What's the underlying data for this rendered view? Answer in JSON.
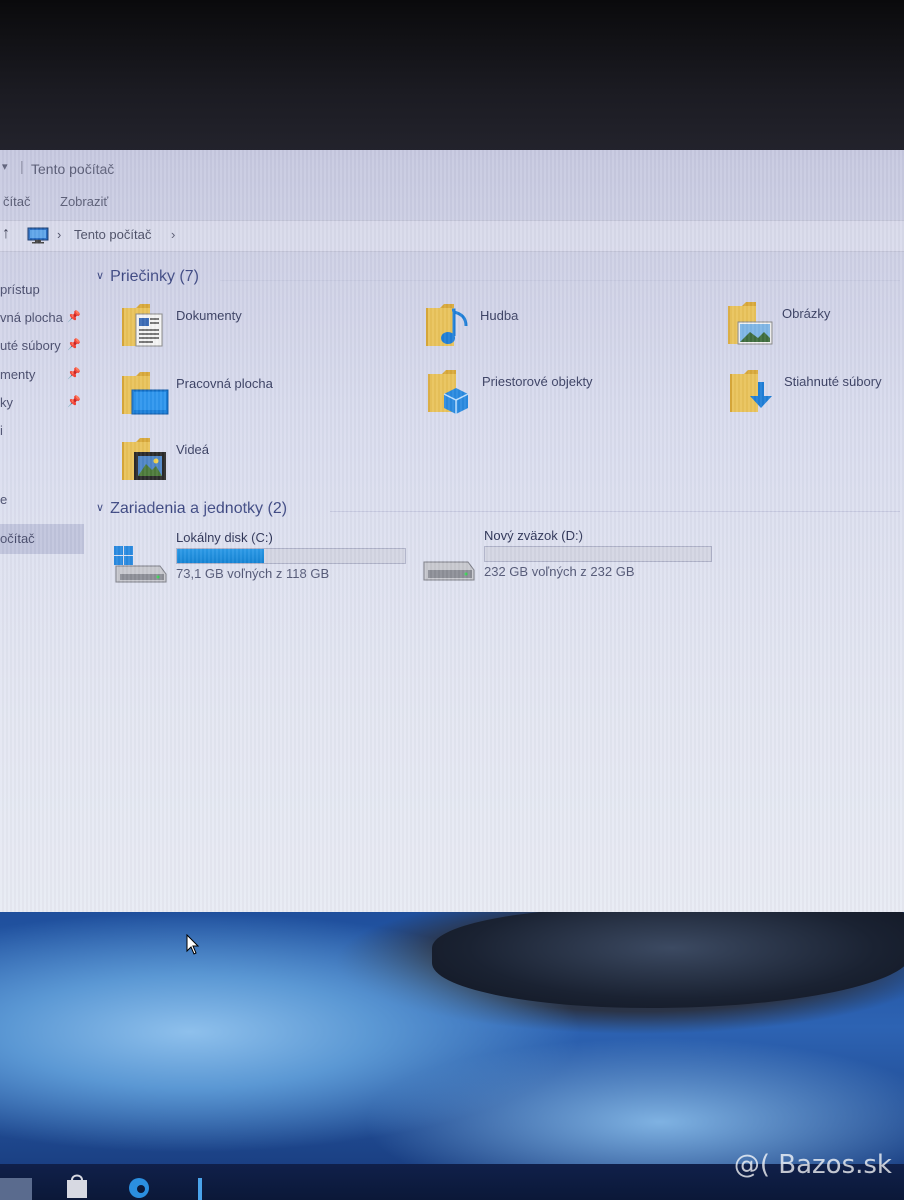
{
  "window": {
    "title": "Tento počítač",
    "quick_access_glyph": "▾",
    "separator": "|"
  },
  "ribbon": {
    "tabs": [
      "čítač",
      "Zobraziť"
    ]
  },
  "address": {
    "up_glyph": "↑",
    "chevron": "›",
    "crumb": "Tento počítač"
  },
  "nav": {
    "items": [
      {
        "label": "prístup",
        "pinned": false
      },
      {
        "label": "vná plocha",
        "pinned": true
      },
      {
        "label": "uté súbory",
        "pinned": true
      },
      {
        "label": "menty",
        "pinned": true
      },
      {
        "label": "ky",
        "pinned": true
      },
      {
        "label": "i",
        "pinned": false
      },
      {
        "label": "e",
        "pinned": false
      },
      {
        "label": "očítač",
        "pinned": false,
        "selected": true
      }
    ],
    "pin_glyph": "📌"
  },
  "folders": {
    "heading": "Priečinky (7)",
    "items": [
      {
        "label": "Dokumenty",
        "icon": "documents-folder-icon"
      },
      {
        "label": "Hudba",
        "icon": "music-folder-icon"
      },
      {
        "label": "Obrázky",
        "icon": "pictures-folder-icon"
      },
      {
        "label": "Pracovná plocha",
        "icon": "desktop-folder-icon"
      },
      {
        "label": "Priestorové objekty",
        "icon": "3d-objects-folder-icon"
      },
      {
        "label": "Stiahnuté súbory",
        "icon": "downloads-folder-icon"
      },
      {
        "label": "Videá",
        "icon": "videos-folder-icon"
      }
    ]
  },
  "devices": {
    "heading": "Zariadenia a jednotky (2)",
    "items": [
      {
        "name": "Lokálny disk (C:)",
        "info": "73,1 GB voľných z 118 GB",
        "used_fraction": 0.38,
        "icon": "windows-drive-icon"
      },
      {
        "name": "Nový zväzok (D:)",
        "info": "232 GB voľných z 232 GB",
        "used_fraction": 0.0,
        "icon": "drive-icon"
      }
    ]
  },
  "watermark": "@( Bazos.sk",
  "colors": {
    "accent": "#1685d6",
    "folder": "#e8bd4a",
    "heading": "#3f4a84"
  }
}
